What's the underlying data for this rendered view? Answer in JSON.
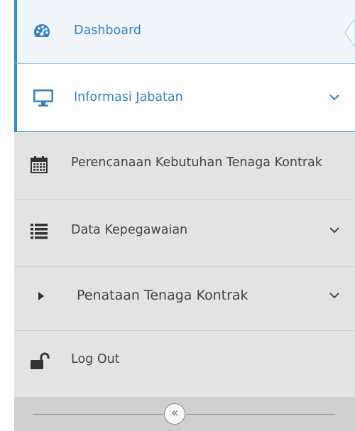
{
  "sidebar": {
    "items": [
      {
        "label": "Dashboard",
        "icon": "dashboard-gauge-icon"
      },
      {
        "label": "Informasi Jabatan",
        "icon": "monitor-icon",
        "expandable": true
      },
      {
        "label": "Perencanaan Kebutuhan Tenaga Kontrak",
        "icon": "calendar-icon"
      },
      {
        "label": "Data Kepegawaian",
        "icon": "list-icon",
        "expandable": true
      },
      {
        "label": "Penataan Tenaga Kontrak",
        "icon": "caret-right-icon",
        "expandable": true
      },
      {
        "label": "Log Out",
        "icon": "unlock-icon"
      }
    ],
    "collapse_symbol": "«"
  },
  "colors": {
    "active": "#2e83c7",
    "sidebar_bg": "#e3e3e3",
    "footer_bg": "#cfcfcf",
    "text": "#444444"
  }
}
